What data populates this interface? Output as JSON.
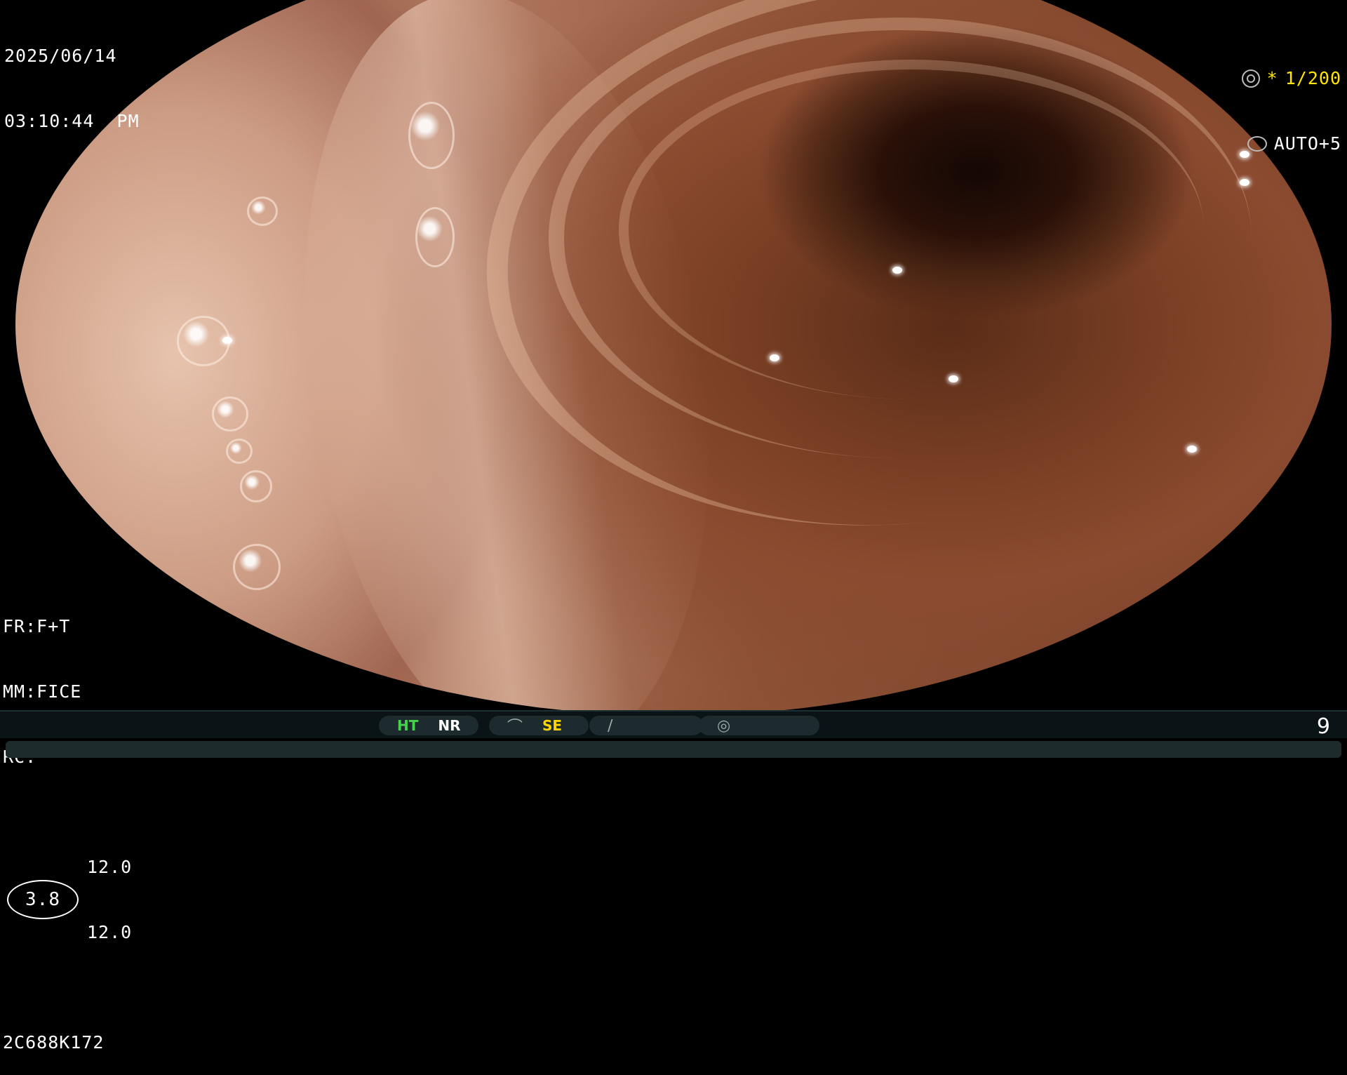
{
  "overlay": {
    "date": "2025/06/14",
    "time": "03:10:44  PM",
    "shutter_marker": "*",
    "shutter": "1/200",
    "exposure": "AUTO+5",
    "fr": "FR:F+T",
    "mm": "MM:FICE",
    "rc": "RC:",
    "ring_value": "3.8",
    "ring_val_1": "12.0",
    "ring_val_2": "12.0",
    "serial": "2C688K172"
  },
  "statusbar": {
    "ht": "HT",
    "nr": "NR",
    "se": "SE",
    "page_number": "9"
  },
  "icons": {
    "shutter": "aperture-icon",
    "exposure": "iris-icon",
    "se": "structure-enhance-icon",
    "slot3": "slash-icon",
    "slot4": "scope-icon"
  },
  "colors": {
    "ht_active": "#44d34a",
    "se_active": "#ffd400",
    "marker": "#ffe600"
  }
}
